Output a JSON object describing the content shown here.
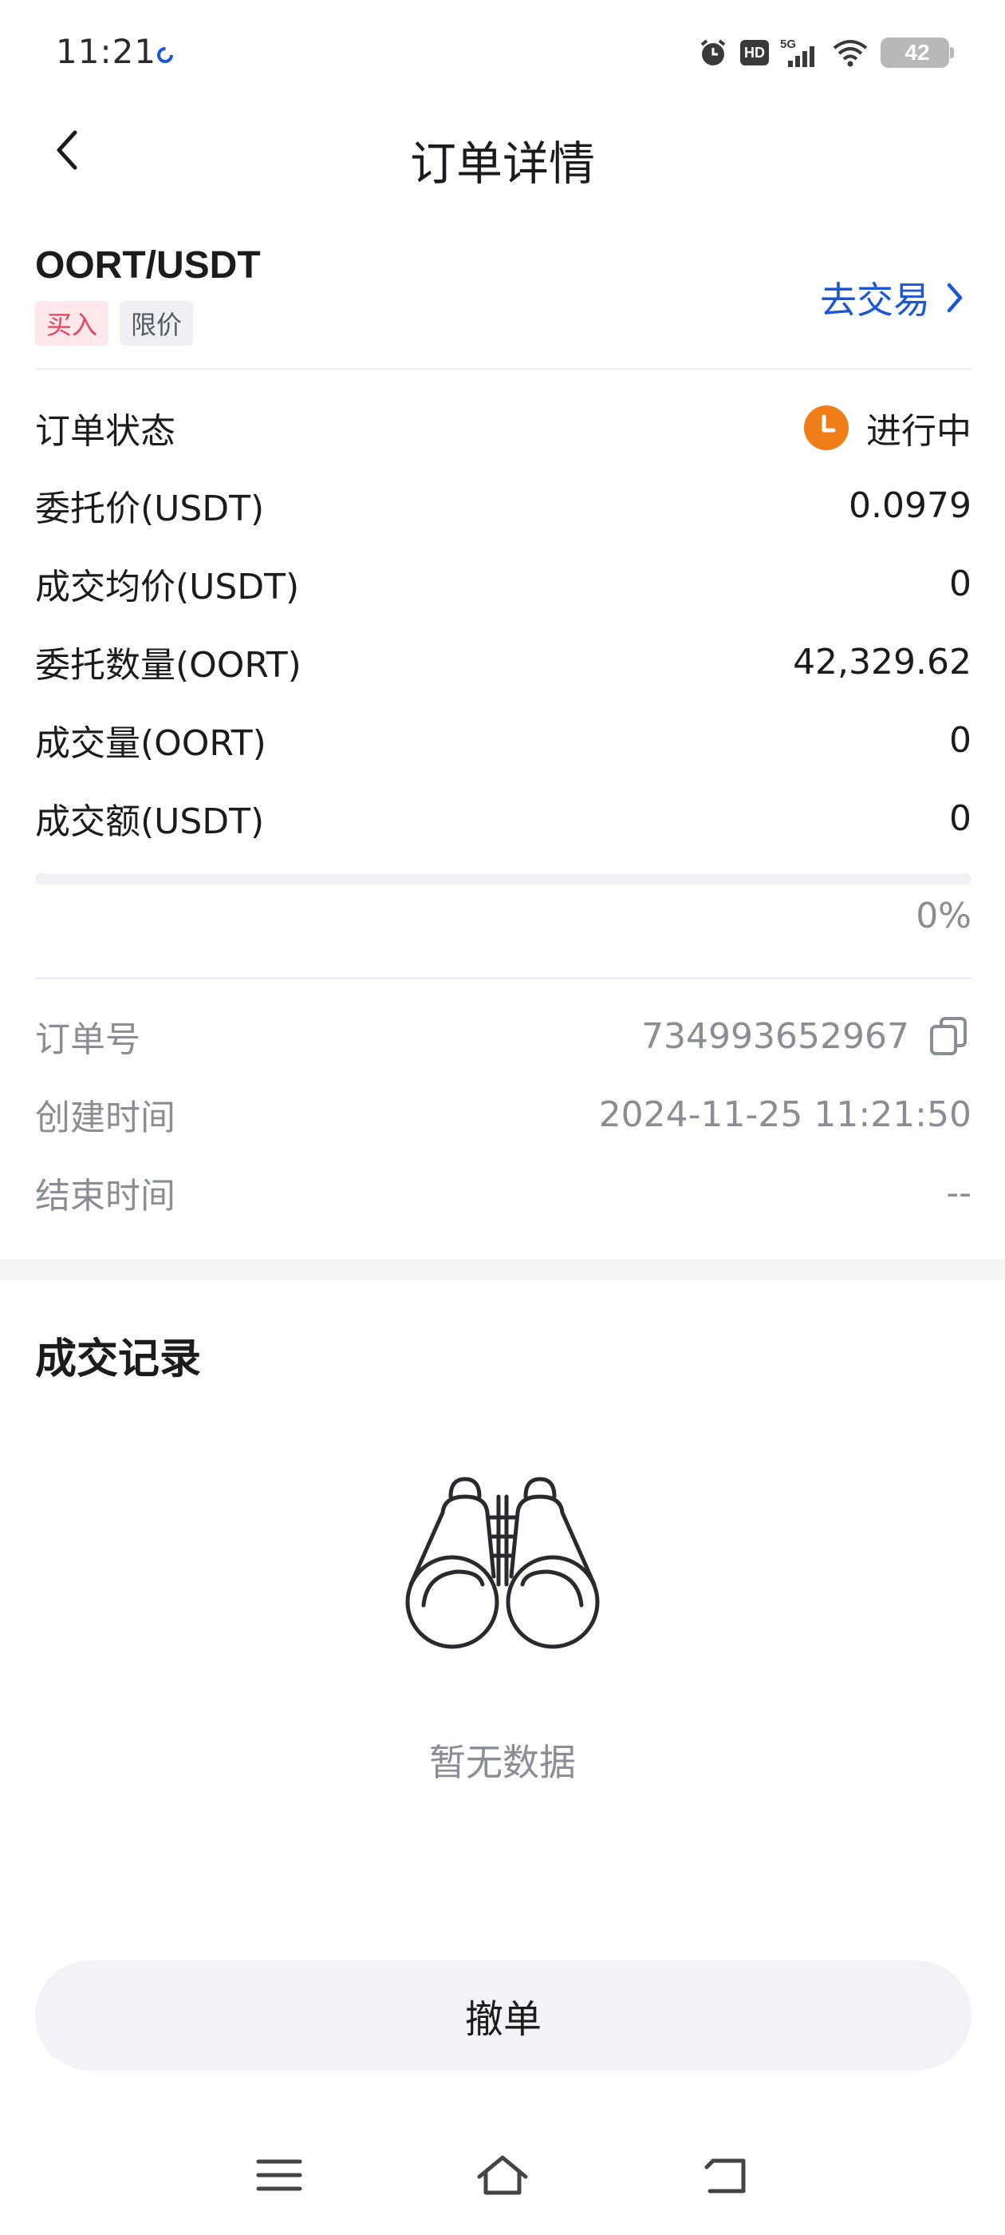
{
  "status_bar": {
    "time": "11:21",
    "hd": "HD",
    "network": "5G",
    "battery": "42"
  },
  "nav": {
    "title": "订单详情"
  },
  "order": {
    "pair": "OORT/USDT",
    "side_tag": "买入",
    "type_tag": "限价",
    "trade_link": "去交易"
  },
  "rows": [
    {
      "label": "订单状态",
      "value": "进行中"
    },
    {
      "label": "委托价(USDT)",
      "value": "0.0979"
    },
    {
      "label": "成交均价(USDT)",
      "value": "0"
    },
    {
      "label": "委托数量(OORT)",
      "value": "42,329.62"
    },
    {
      "label": "成交量(OORT)",
      "value": "0"
    },
    {
      "label": "成交额(USDT)",
      "value": "0"
    }
  ],
  "progress": {
    "fraction": 0,
    "text": "0%"
  },
  "meta": [
    {
      "label": "订单号",
      "value": "734993652967"
    },
    {
      "label": "创建时间",
      "value": "2024-11-25 11:21:50"
    },
    {
      "label": "结束时间",
      "value": "--"
    }
  ],
  "records": {
    "title": "成交记录",
    "empty_text": "暂无数据"
  },
  "actions": {
    "cancel": "撤单"
  },
  "colors": {
    "accent": "#1a57d6",
    "buy": "#e8455b",
    "status_pending": "#ef7d18"
  },
  "icons": {
    "back": "chevron-left-icon",
    "trade": "chevron-right-icon",
    "status": "clock-icon",
    "copy": "copy-icon",
    "empty": "binoculars-icon",
    "menu": "menu-icon",
    "home": "home-icon",
    "back_nav": "return-icon"
  }
}
